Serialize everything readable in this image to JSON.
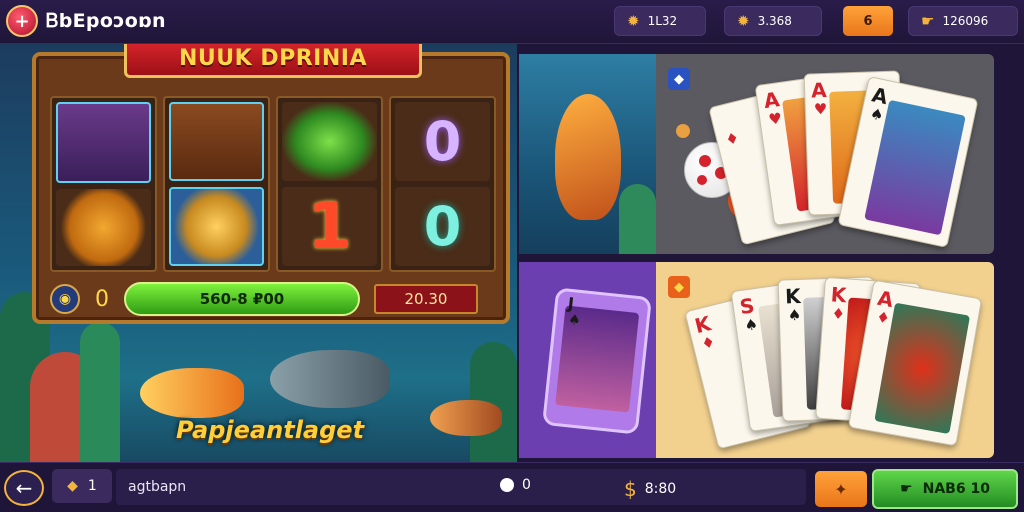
{
  "brand": {
    "logo_icon": "+",
    "name": "ᏴbEpoɔoɒn"
  },
  "topbar": {
    "stat1": {
      "icon": "gear-coin-icon",
      "value": "1L32"
    },
    "stat2": {
      "icon": "gear-coin-icon",
      "value": "3.368"
    },
    "orange_label": "6",
    "stat3": {
      "icon": "hand-coins-icon",
      "value": "126096"
    }
  },
  "slot": {
    "title": "NUUK DPRINIA",
    "reel_symbols": [
      "",
      "",
      "",
      "",
      "1",
      "",
      "0",
      "0"
    ],
    "coin_value": "0",
    "bar_value": "560-8 ₽00",
    "red_value": "20.30"
  },
  "scene_caption": "Papjeantlaget",
  "cards_top": [
    {
      "rank": "",
      "suit": "♦",
      "color": "red"
    },
    {
      "rank": "A",
      "suit": "♥",
      "color": "red"
    },
    {
      "rank": "A",
      "suit": "♥",
      "color": "red"
    },
    {
      "rank": "A",
      "suit": "♠",
      "color": "black"
    }
  ],
  "cards_bottom": [
    {
      "rank": "K",
      "suit": "♦",
      "color": "red"
    },
    {
      "rank": "S",
      "suit": "♠",
      "color": "red"
    },
    {
      "rank": "K",
      "suit": "♠",
      "color": "black"
    },
    {
      "rank": "K",
      "suit": "♦",
      "color": "red"
    },
    {
      "rank": "A",
      "suit": "♦",
      "color": "red"
    }
  ],
  "phone_card": {
    "rank": "J",
    "suit": "♠"
  },
  "bottombar": {
    "chip_value": "1",
    "input_text": "agtbapn",
    "dot_value": "0",
    "coin_value": "8:80",
    "green_label": "NAB6 10"
  },
  "colors": {
    "accent_orange": "#f08a24",
    "accent_green": "#3cb832",
    "purple_bg": "#1f1538"
  }
}
